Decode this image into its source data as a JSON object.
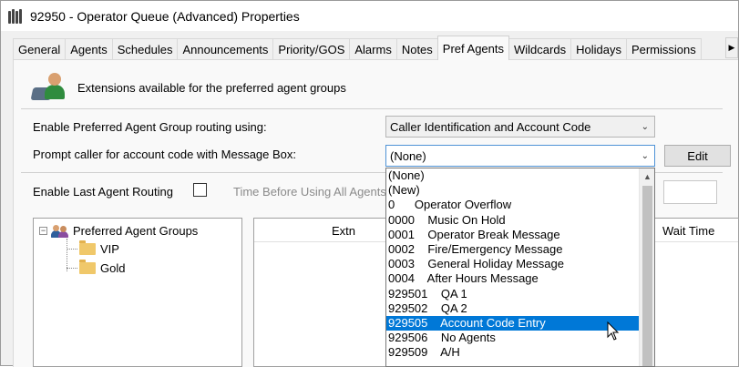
{
  "window": {
    "title": "92950 - Operator Queue (Advanced) Properties"
  },
  "tabs": [
    "General",
    "Agents",
    "Schedules",
    "Announcements",
    "Priority/GOS",
    "Alarms",
    "Notes",
    "Pref Agents",
    "Wildcards",
    "Holidays",
    "Permissions"
  ],
  "active_tab": "Pref Agents",
  "header": {
    "text": "Extensions available for the preferred agent groups"
  },
  "routing": {
    "label": "Enable Preferred Agent Group routing using:",
    "value": "Caller Identification and Account Code"
  },
  "prompt": {
    "label": "Prompt caller for account code with Message Box:",
    "value": "(None)",
    "edit_label": "Edit"
  },
  "last_agent": {
    "label": "Enable Last Agent Routing",
    "checked": false,
    "time_label": "Time Before Using All Agents"
  },
  "tree": {
    "root": "Preferred Agent Groups",
    "children": [
      "VIP",
      "Gold"
    ]
  },
  "grid": {
    "columns": [
      "Extn",
      "Wait Time"
    ]
  },
  "dropdown": {
    "items": [
      "(None)",
      "(New)",
      "0      Operator Overflow",
      "0000    Music On Hold",
      "0001    Operator Break Message",
      "0002    Fire/Emergency Message",
      "0003    General Holiday Message",
      "0004    After Hours Message",
      "929501    QA 1",
      "929502    QA 2",
      "929505    Account Code Entry",
      "929506    No Agents",
      "929509    A/H"
    ],
    "selected_index": 10
  }
}
